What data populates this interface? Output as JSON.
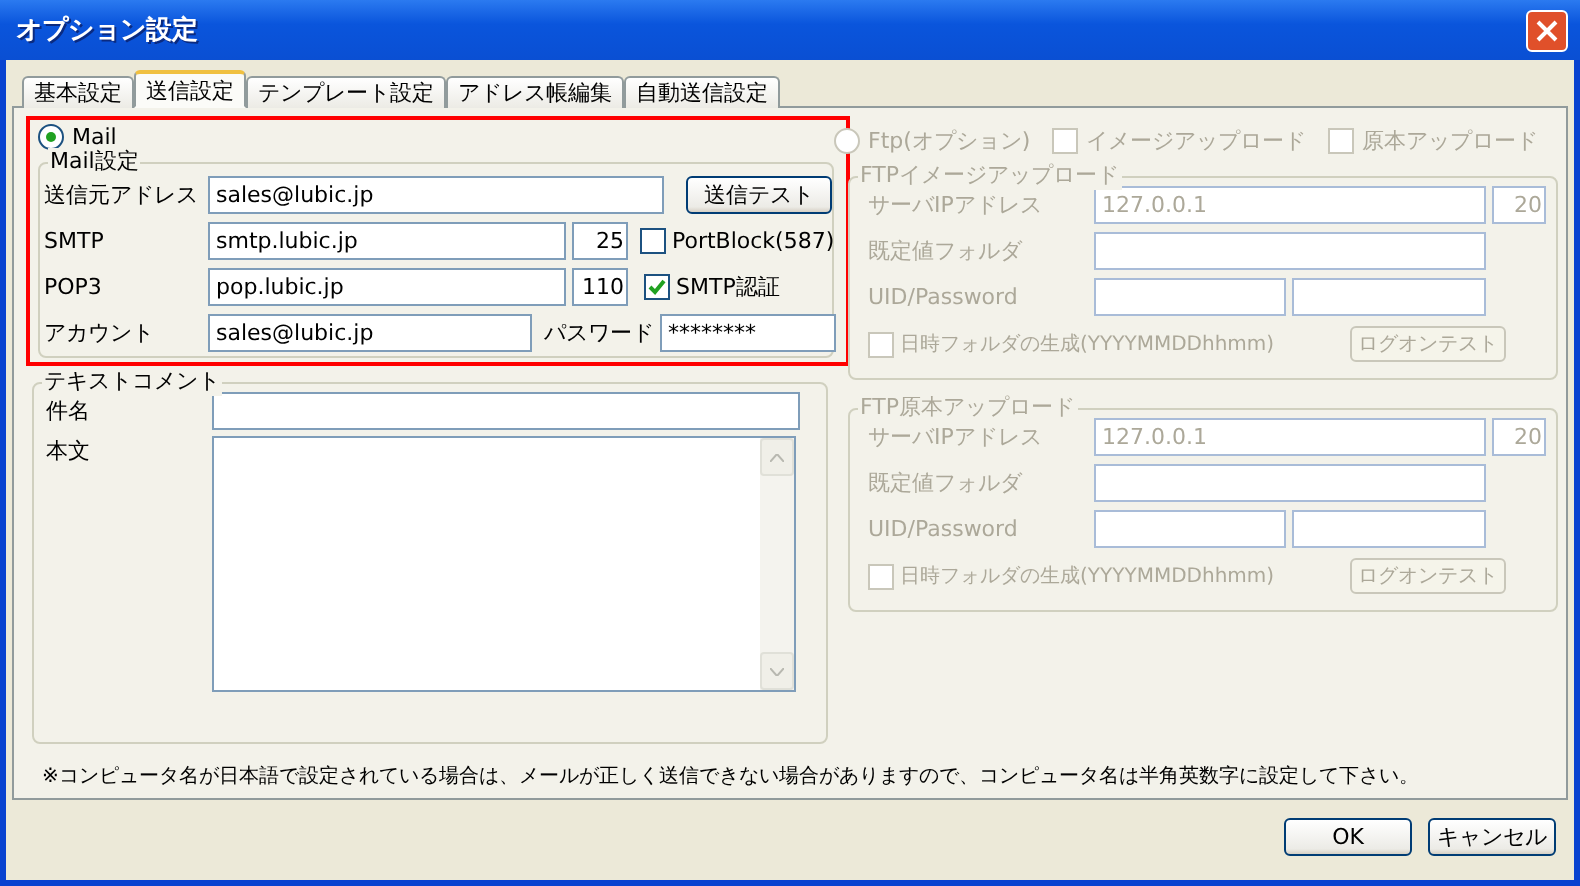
{
  "window": {
    "title": "オプション設定"
  },
  "tabs": [
    {
      "label": "基本設定",
      "selected": false
    },
    {
      "label": "送信設定",
      "selected": true
    },
    {
      "label": "テンプレート設定",
      "selected": false
    },
    {
      "label": "アドレス帳編集",
      "selected": false
    },
    {
      "label": "自動送信設定",
      "selected": false
    }
  ],
  "mail": {
    "option": {
      "label": "Mail",
      "selected": true
    },
    "group_label": "Mail設定",
    "sender": {
      "label": "送信元アドレス",
      "value": "sales@lubic.jp"
    },
    "test_button": "送信テスト",
    "smtp": {
      "label": "SMTP",
      "value": "smtp.lubic.jp",
      "port": "25"
    },
    "port_block": {
      "label": "PortBlock(587)",
      "checked": false
    },
    "pop3": {
      "label": "POP3",
      "value": "pop.lubic.jp",
      "port": "110"
    },
    "smtp_auth": {
      "label": "SMTP認証",
      "checked": true
    },
    "account": {
      "label": "アカウント",
      "value": "sales@lubic.jp"
    },
    "password": {
      "label": "パスワード",
      "value": "********"
    }
  },
  "text_comment": {
    "group_label": "テキストコメント",
    "subject_label": "件名",
    "body_label": "本文"
  },
  "ftp": {
    "option": {
      "label": "Ftp(オプション)",
      "selected": false
    },
    "disabled": true,
    "image_upload": {
      "label": "イメージアップロード",
      "checked": false
    },
    "original_upload": {
      "label": "原本アップロード",
      "checked": false
    },
    "groups": [
      {
        "title": "FTPイメージアップロード",
        "server_label": "サーバIPアドレス",
        "server_ip": "127.0.0.1",
        "port": "20",
        "folder_label": "既定値フォルダ",
        "uid_label": "UID/Password",
        "dated_folder": {
          "label": "日時フォルダの生成(YYYYMMDDhhmm)",
          "checked": false
        },
        "logon_button": "ログオンテスト"
      },
      {
        "title": "FTP原本アップロード",
        "server_label": "サーバIPアドレス",
        "server_ip": "127.0.0.1",
        "port": "20",
        "folder_label": "既定値フォルダ",
        "uid_label": "UID/Password",
        "dated_folder": {
          "label": "日時フォルダの生成(YYYYMMDDhhmm)",
          "checked": false
        },
        "logon_button": "ログオンテスト"
      }
    ]
  },
  "note": "※コンピュータ名が日本語で設定されている場合は、メールが正しく送信できない場合がありますので、コンピュータ名は半角英数字に設定して下さい。",
  "buttons": [
    "OK",
    "キャンセル"
  ]
}
